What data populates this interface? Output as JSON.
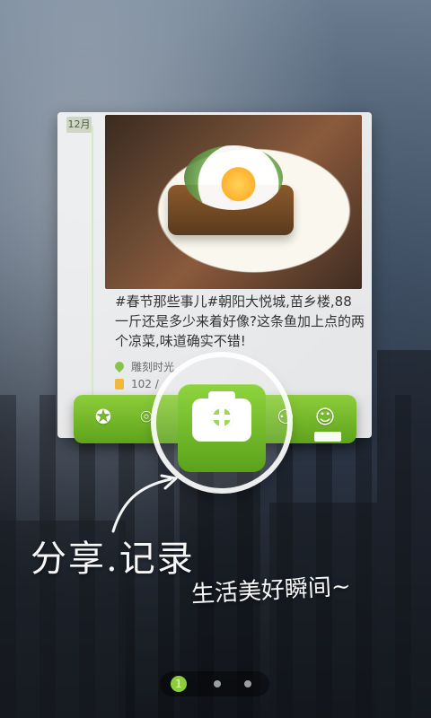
{
  "post": {
    "date_chip": "12月",
    "text": "#春节那些事儿#朝阳大悦城,苗乡楼,88一斤还是多少来着好像?这条鱼加上点的两个凉菜,味道确实不错!",
    "location": "雕刻时光",
    "likes": "102 /"
  },
  "tabs": {
    "left1": "✪",
    "left2": "⌾",
    "right1": "⚇",
    "right2": "☺"
  },
  "slogan": {
    "line1": "分享.记录",
    "line2": "生活美好瞬间~"
  },
  "pager": {
    "current": "1"
  }
}
